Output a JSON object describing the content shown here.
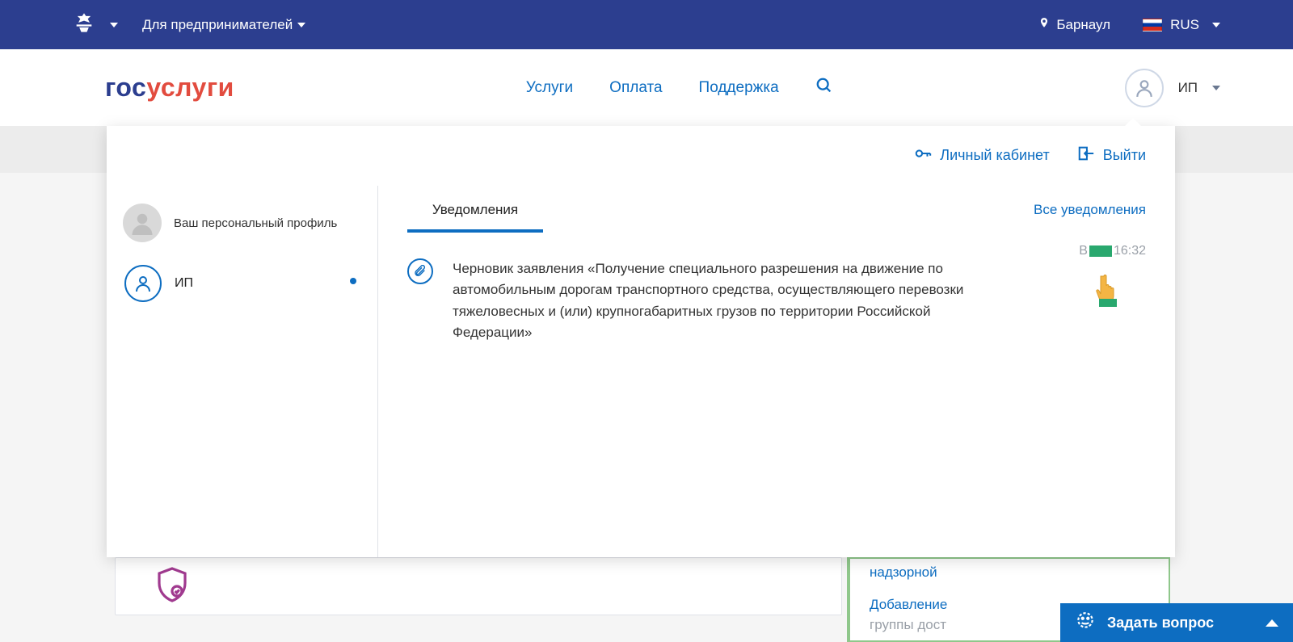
{
  "topbar": {
    "audience_label": "Для предпринимателей",
    "location": "Барнаул",
    "lang": "RUS"
  },
  "logo": {
    "part1": "гос",
    "part2": "услуги"
  },
  "nav": {
    "services": "Услуги",
    "payment": "Оплата",
    "support": "Поддержка"
  },
  "user": {
    "short": "ИП"
  },
  "dropdown": {
    "personal_cabinet": "Личный кабинет",
    "logout": "Выйти",
    "profile_caption": "Ваш персональный профиль",
    "ip_label": "ИП",
    "tab_notifications": "Уведомления",
    "all_notifications": "Все уведомления",
    "notification_text": "Черновик заявления «Получение специального разрешения на движение по автомобильным дорогам транспортного средства, осуществляющего перевозки тяжеловесных и (или) крупногабаритных грузов по территории Российской Федерации»",
    "notification_time_prefix": "В",
    "notification_time": "16:32"
  },
  "behind": {
    "right_line1": "надзорной",
    "right_line2": "Добавление",
    "right_line2_gray": "группы дост"
  },
  "askbar": {
    "label": "Задать вопрос"
  }
}
